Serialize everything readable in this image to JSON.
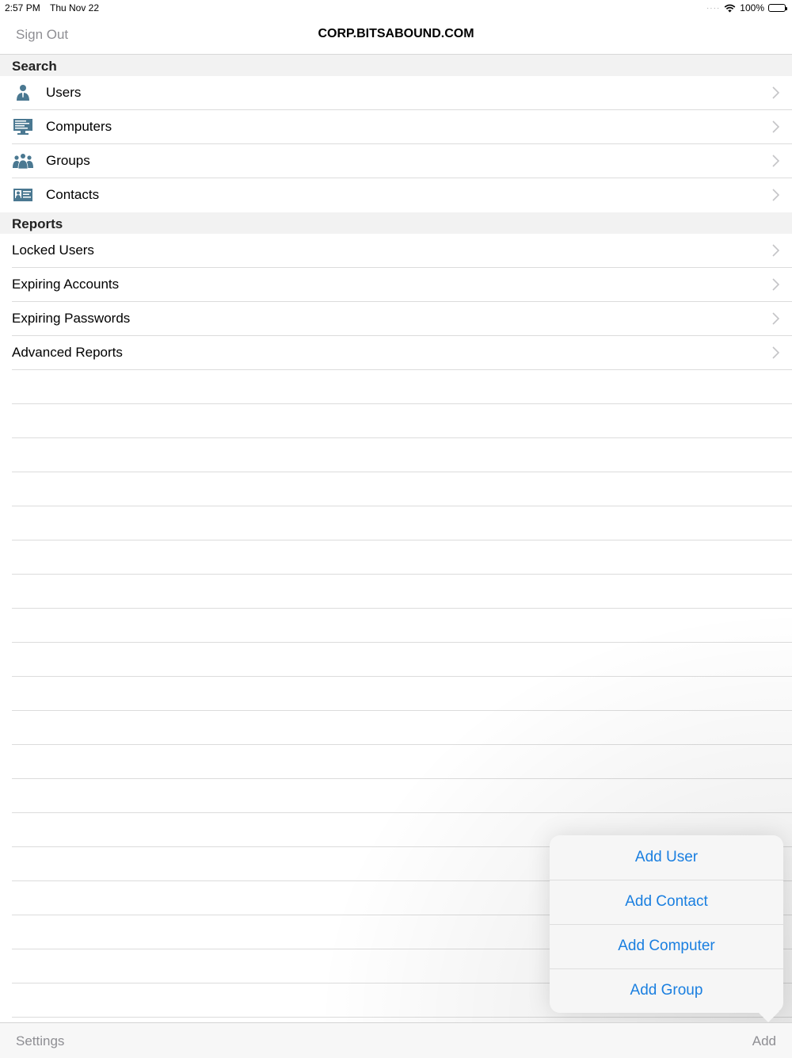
{
  "status": {
    "time": "2:57 PM",
    "date": "Thu Nov 22",
    "battery": "100%"
  },
  "nav": {
    "left_label": "Sign Out",
    "title": "CORP.BITSABOUND.COM"
  },
  "search": {
    "header": "Search",
    "items": [
      {
        "label": "Users",
        "icon": "user-icon"
      },
      {
        "label": "Computers",
        "icon": "computer-icon"
      },
      {
        "label": "Groups",
        "icon": "groups-icon"
      },
      {
        "label": "Contacts",
        "icon": "contact-card-icon"
      }
    ]
  },
  "reports": {
    "header": "Reports",
    "items": [
      {
        "label": "Locked Users"
      },
      {
        "label": "Expiring Accounts"
      },
      {
        "label": "Expiring Passwords"
      },
      {
        "label": "Advanced Reports"
      }
    ]
  },
  "popover": {
    "items": [
      "Add User",
      "Add Contact",
      "Add Computer",
      "Add Group"
    ]
  },
  "toolbar": {
    "left_label": "Settings",
    "right_label": "Add"
  },
  "colors": {
    "accent": "#1a7fe0",
    "icon": "#4a7891",
    "muted": "#8e8e93"
  }
}
